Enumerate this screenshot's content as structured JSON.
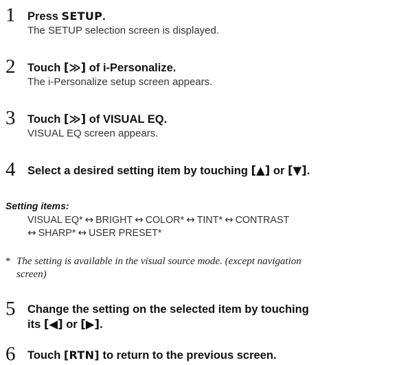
{
  "steps": [
    {
      "number": "1",
      "title_prefix": "Press ",
      "title_keyword": "SETUP",
      "title_suffix": ".",
      "description": "The SETUP selection screen is displayed."
    },
    {
      "number": "2",
      "title_prefix": "Touch ",
      "title_button": "[≫]",
      "title_suffix": " of i-Personalize.",
      "description": "The i-Personalize setup screen appears."
    },
    {
      "number": "3",
      "title_prefix": "Touch ",
      "title_button": "[≫]",
      "title_suffix": " of VISUAL EQ.",
      "description": "VISUAL EQ screen appears."
    },
    {
      "number": "4",
      "title_prefix": "Select a desired setting item by touching ",
      "title_button_1": "[▲]",
      "title_middle": " or ",
      "title_button_2": "[▼]",
      "title_suffix": "."
    },
    {
      "number": "5",
      "title_line1": "Change the setting on the selected item by touching",
      "title_line2_prefix": "its ",
      "title_button_1": "[◀]",
      "title_middle": " or ",
      "title_button_2": "[▶]",
      "title_suffix": "."
    },
    {
      "number": "6",
      "title_prefix": "Touch ",
      "title_button": "[RTN]",
      "title_suffix": " to return to the previous screen."
    }
  ],
  "setting_items": {
    "heading": "Setting items:",
    "line1": [
      "VISUAL EQ*",
      "↔",
      "BRIGHT",
      "↔",
      "COLOR*",
      "↔",
      "TINT*",
      "↔",
      "CONTRAST"
    ],
    "line2": [
      "↔",
      "SHARP*",
      "↔",
      "USER PRESET*"
    ]
  },
  "note": {
    "mark": "*",
    "line1": "The setting is available in the visual source mode. (except navigation",
    "line2": "screen)"
  }
}
